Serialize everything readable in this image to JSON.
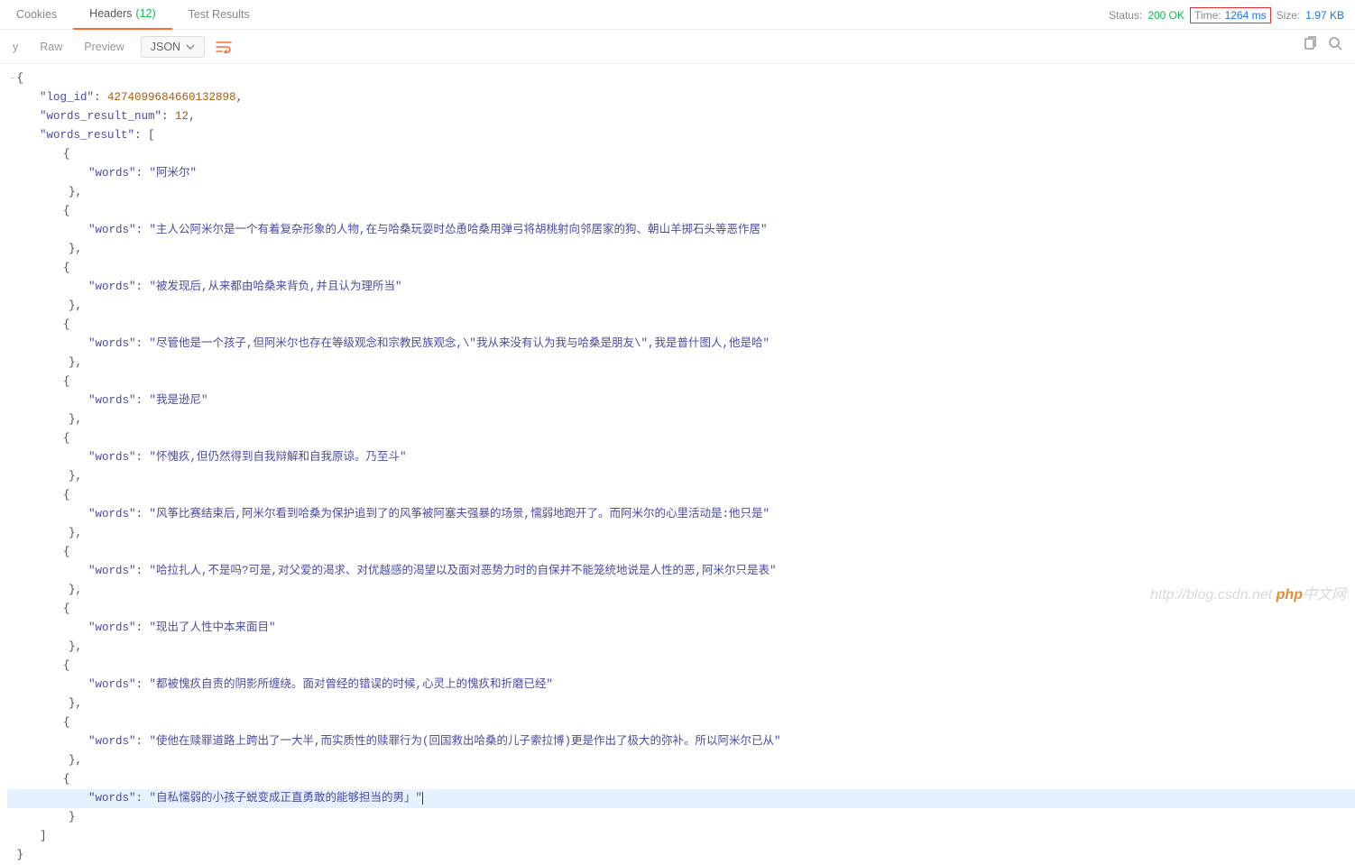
{
  "tabs": {
    "cookies": "Cookies",
    "headers": "Headers",
    "headers_count": "(12)",
    "test_results": "Test Results"
  },
  "status": {
    "status_label": "Status:",
    "status_value": "200 OK",
    "time_label": "Time:",
    "time_value": "1264 ms",
    "size_label": "Size:",
    "size_value": "1.97 KB"
  },
  "toolbar": {
    "y": "y",
    "raw": "Raw",
    "preview": "Preview",
    "json": "JSON"
  },
  "response": {
    "log_id_key": "\"log_id\"",
    "log_id_val": "4274099684660132898",
    "wrn_key": "\"words_result_num\"",
    "wrn_val": "12",
    "wr_key": "\"words_result\"",
    "words_key": "\"words\"",
    "items": [
      "\"阿米尔\"",
      "\"主人公阿米尔是一个有着复杂形象的人物,在与哈桑玩耍时怂恿哈桑用弹弓将胡桃射向邻居家的狗、朝山羊掷石头等恶作居\"",
      "\"被发现后,从来都由哈桑来背负,并且认为理所当\"",
      "\"尽管他是一个孩子,但阿米尔也存在等级观念和宗教民族观念,\\\"我从来没有认为我与哈桑是朋友\\\",我是普什图人,他是哈\"",
      "\"我是逊尼\"",
      "\"怀愧疚,但仍然得到自我辩解和自我原谅。乃至斗\"",
      "\"风筝比赛结束后,阿米尔看到哈桑为保护追到了的风筝被阿塞夫强暴的场景,懦弱地跑开了。而阿米尔的心里活动是:他只是\"",
      "\"哈拉扎人,不是吗?可是,对父爱的渴求、对优越感的渴望以及面对恶势力时的自保并不能笼统地说是人性的恶,阿米尔只是表\"",
      "\"现出了人性中本来面目\"",
      "\"都被愧疚自责的阴影所缠绕。面对曾经的错误的时候,心灵上的愧疚和折磨已经\"",
      "\"使他在赎罪道路上跨出了一大半,而实质性的赎罪行为(回国救出哈桑的儿子索拉博)更是作出了极大的弥补。所以阿米尔已从\"",
      "\"自私懦弱的小孩子蜕变成正直勇敢的能够担当的男」\""
    ]
  },
  "watermark": {
    "url": "http://blog.csdn.net",
    "php": "php",
    "cn": "中文网"
  }
}
